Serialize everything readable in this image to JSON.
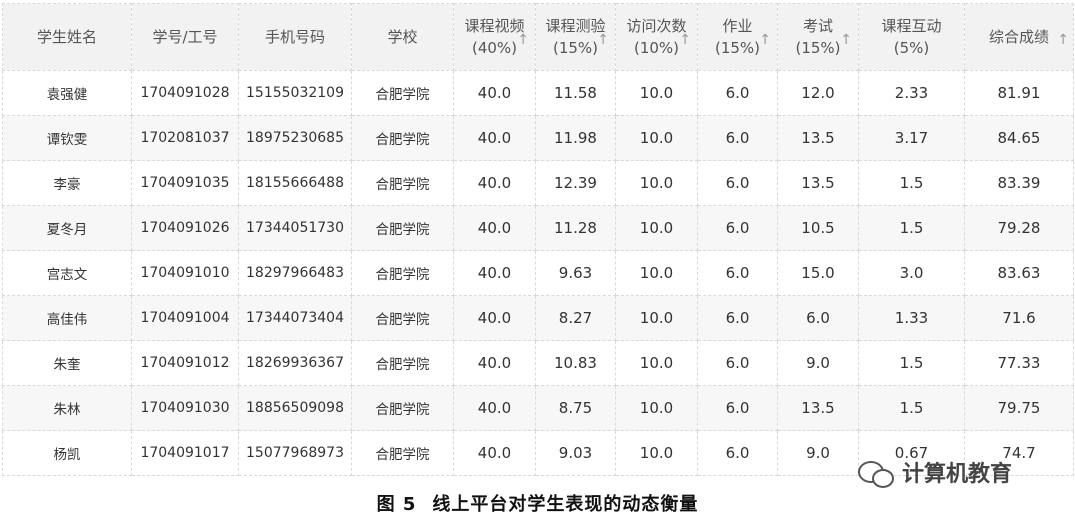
{
  "table": {
    "headers": [
      {
        "line1": "学生姓名",
        "line2": "",
        "sort": false
      },
      {
        "line1": "学号/工号",
        "line2": "",
        "sort": false
      },
      {
        "line1": "手机号码",
        "line2": "",
        "sort": false
      },
      {
        "line1": "学校",
        "line2": "",
        "sort": false
      },
      {
        "line1": "课程视频",
        "line2": "(40%)",
        "sort": true
      },
      {
        "line1": "课程测验",
        "line2": "(15%)",
        "sort": true
      },
      {
        "line1": "访问次数",
        "line2": "(10%)",
        "sort": true
      },
      {
        "line1": "作业",
        "line2": "(15%)",
        "sort": true
      },
      {
        "line1": "考试",
        "line2": "(15%)",
        "sort": true
      },
      {
        "line1": "课程互动",
        "line2": "(5%)",
        "sort": false
      },
      {
        "line1": "综合成绩",
        "line2": "",
        "sort": true
      }
    ],
    "rows": [
      [
        "袁强健",
        "1704091028",
        "15155032109",
        "合肥学院",
        "40.0",
        "11.58",
        "10.0",
        "6.0",
        "12.0",
        "2.33",
        "81.91"
      ],
      [
        "谭钦雯",
        "1702081037",
        "18975230685",
        "合肥学院",
        "40.0",
        "11.98",
        "10.0",
        "6.0",
        "13.5",
        "3.17",
        "84.65"
      ],
      [
        "李豪",
        "1704091035",
        "18155666488",
        "合肥学院",
        "40.0",
        "12.39",
        "10.0",
        "6.0",
        "13.5",
        "1.5",
        "83.39"
      ],
      [
        "夏冬月",
        "1704091026",
        "17344051730",
        "合肥学院",
        "40.0",
        "11.28",
        "10.0",
        "6.0",
        "10.5",
        "1.5",
        "79.28"
      ],
      [
        "宫志文",
        "1704091010",
        "18297966483",
        "合肥学院",
        "40.0",
        "9.63",
        "10.0",
        "6.0",
        "15.0",
        "3.0",
        "83.63"
      ],
      [
        "高佳伟",
        "1704091004",
        "17344073404",
        "合肥学院",
        "40.0",
        "8.27",
        "10.0",
        "6.0",
        "6.0",
        "1.33",
        "71.6"
      ],
      [
        "朱奎",
        "1704091012",
        "18269936367",
        "合肥学院",
        "40.0",
        "10.83",
        "10.0",
        "6.0",
        "9.0",
        "1.5",
        "77.33"
      ],
      [
        "朱林",
        "1704091030",
        "18856509098",
        "合肥学院",
        "40.0",
        "8.75",
        "10.0",
        "6.0",
        "13.5",
        "1.5",
        "79.75"
      ],
      [
        "杨凯",
        "1704091017",
        "15077968973",
        "合肥学院",
        "40.0",
        "9.03",
        "10.0",
        "6.0",
        "9.0",
        "0.67",
        "74.7"
      ]
    ]
  },
  "caption": {
    "figure": "图 5",
    "text": "线上平台对学生表现的动态衡量"
  },
  "watermark": {
    "text": "计算机教育"
  },
  "colors": {
    "header_bg": "#f2f2f2",
    "row_alt_bg": "#f7f7f7",
    "border": "#d9d9d9"
  }
}
